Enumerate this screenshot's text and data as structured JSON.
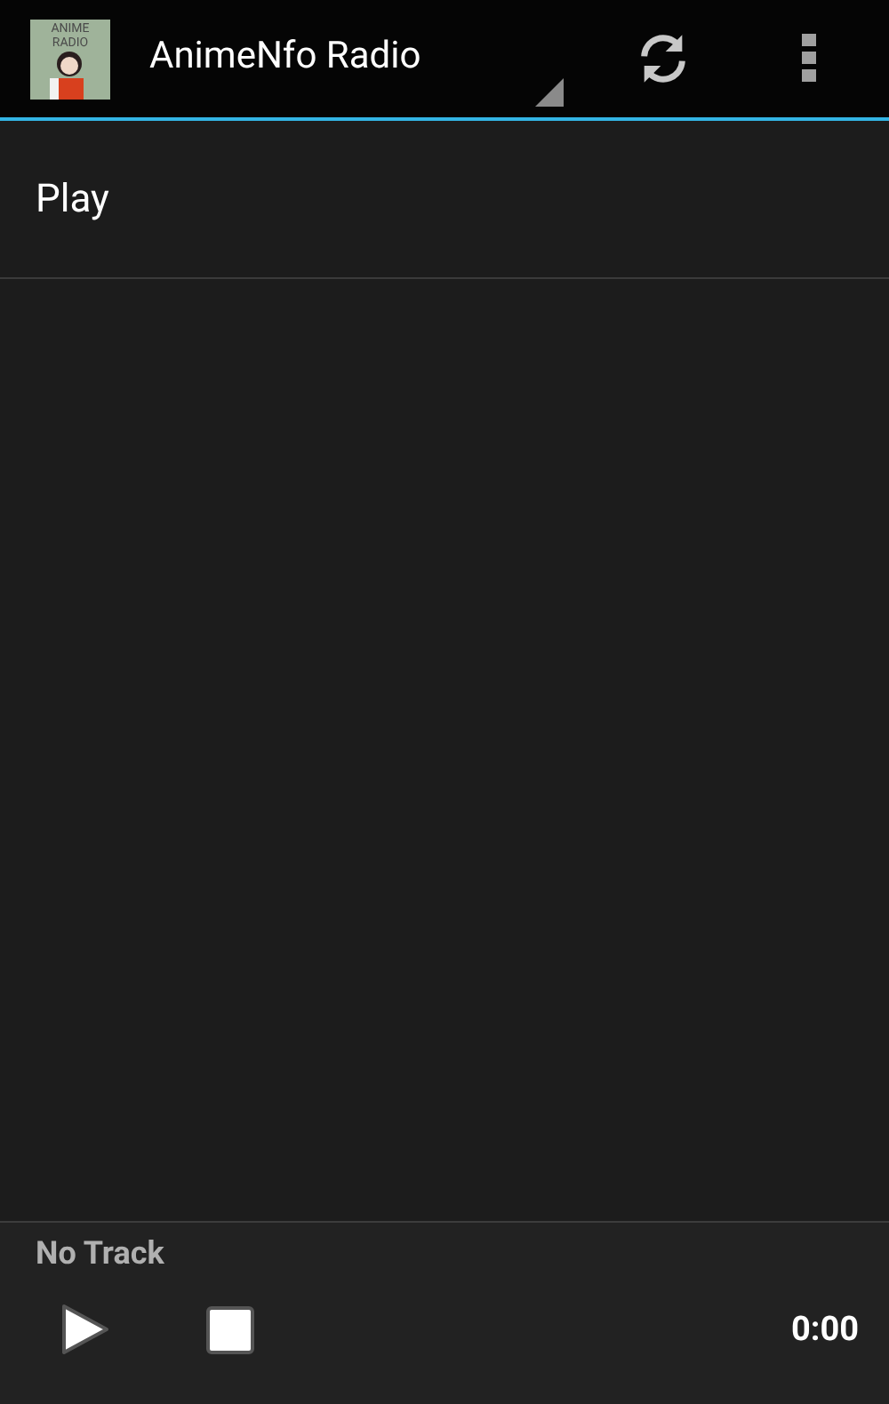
{
  "action_bar": {
    "logo_text": [
      "ANIME",
      "RADIO"
    ],
    "title": "AnimeNfo Radio"
  },
  "list": [
    {
      "label": "Play"
    }
  ],
  "player": {
    "track": "No Track",
    "time": "0:00"
  }
}
